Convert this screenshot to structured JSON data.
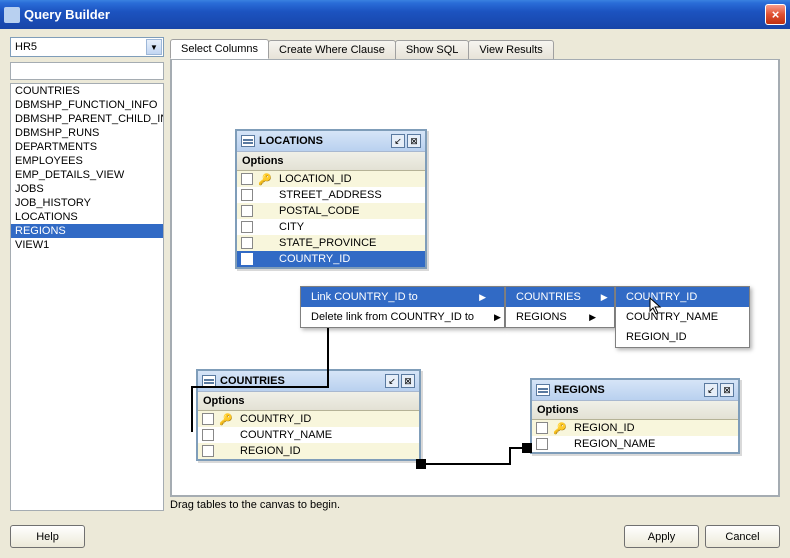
{
  "window_title": "Query Builder",
  "dropdown_value": "HR5",
  "tables_list": [
    "COUNTRIES",
    "DBMSHP_FUNCTION_INFO",
    "DBMSHP_PARENT_CHILD_INFO",
    "DBMSHP_RUNS",
    "DEPARTMENTS",
    "EMPLOYEES",
    "EMP_DETAILS_VIEW",
    "JOBS",
    "JOB_HISTORY",
    "LOCATIONS",
    "REGIONS",
    "VIEW1"
  ],
  "selected_table": "REGIONS",
  "tabs": [
    "Select Columns",
    "Create Where Clause",
    "Show SQL",
    "View Results"
  ],
  "active_tab": 0,
  "canvas": {
    "locations": {
      "title": "LOCATIONS",
      "options_label": "Options",
      "cols": [
        "LOCATION_ID",
        "STREET_ADDRESS",
        "POSTAL_CODE",
        "CITY",
        "STATE_PROVINCE",
        "COUNTRY_ID"
      ]
    },
    "countries": {
      "title": "COUNTRIES",
      "options_label": "Options",
      "cols": [
        "COUNTRY_ID",
        "COUNTRY_NAME",
        "REGION_ID"
      ]
    },
    "regions": {
      "title": "REGIONS",
      "options_label": "Options",
      "cols": [
        "REGION_ID",
        "REGION_NAME"
      ]
    }
  },
  "context_menu": {
    "item1": "Link COUNTRY_ID to",
    "item2": "Delete link from COUNTRY_ID to",
    "sub1_a": "COUNTRIES",
    "sub1_b": "REGIONS",
    "sub2_a": "COUNTRY_ID",
    "sub2_b": "COUNTRY_NAME",
    "sub2_c": "REGION_ID"
  },
  "status_text": "Drag tables to the canvas to begin.",
  "buttons": {
    "help": "Help",
    "apply": "Apply",
    "cancel": "Cancel"
  }
}
